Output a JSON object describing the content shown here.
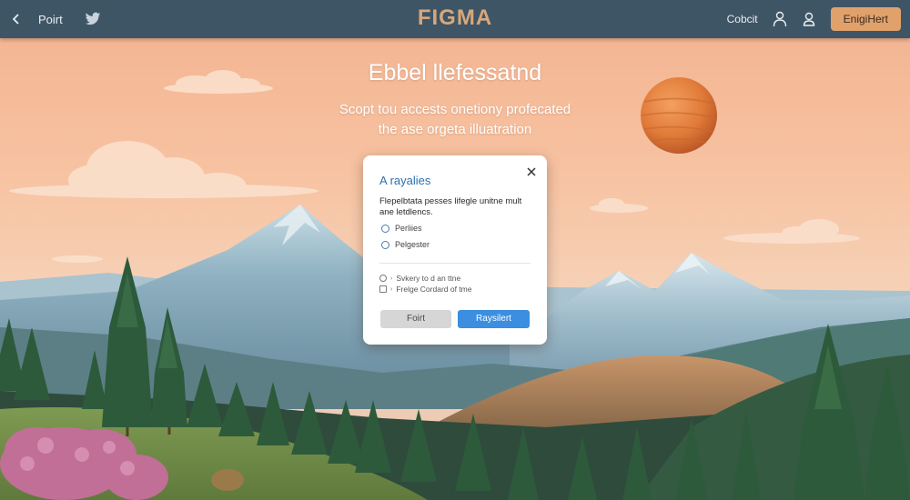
{
  "nav": {
    "back_icon": "chevron-left-icon",
    "left_link": "Poirt",
    "twitter_icon": "twitter-icon",
    "brand": "FIGMA",
    "right_link": "Cobcit",
    "user_icon": "user-icon",
    "account_icon": "user-outline-icon",
    "cta_label": "EnigiHert"
  },
  "hero": {
    "title": "Ebbel llefessatnd",
    "subtitle_line1": "Scopt tou accests onetiony profecated",
    "subtitle_line2": "the ase orgeta illuatration"
  },
  "modal": {
    "title": "A rayalies",
    "close_icon": "close-icon",
    "description": "Flepelbtata pesses lifegle unitne mult ane letdlencs.",
    "options": [
      "Perliies",
      "Pelgester"
    ],
    "links": [
      "Svkery to d an ttne",
      "Frelge Cordard of tme"
    ],
    "secondary_button": "Foirt",
    "primary_button": "Raysilert"
  },
  "colors": {
    "nav_bg": "#3e5566",
    "brand": "#d7a77c",
    "cta": "#e1a16b",
    "primary": "#3b8ee0",
    "modal_title": "#2f6fae"
  }
}
